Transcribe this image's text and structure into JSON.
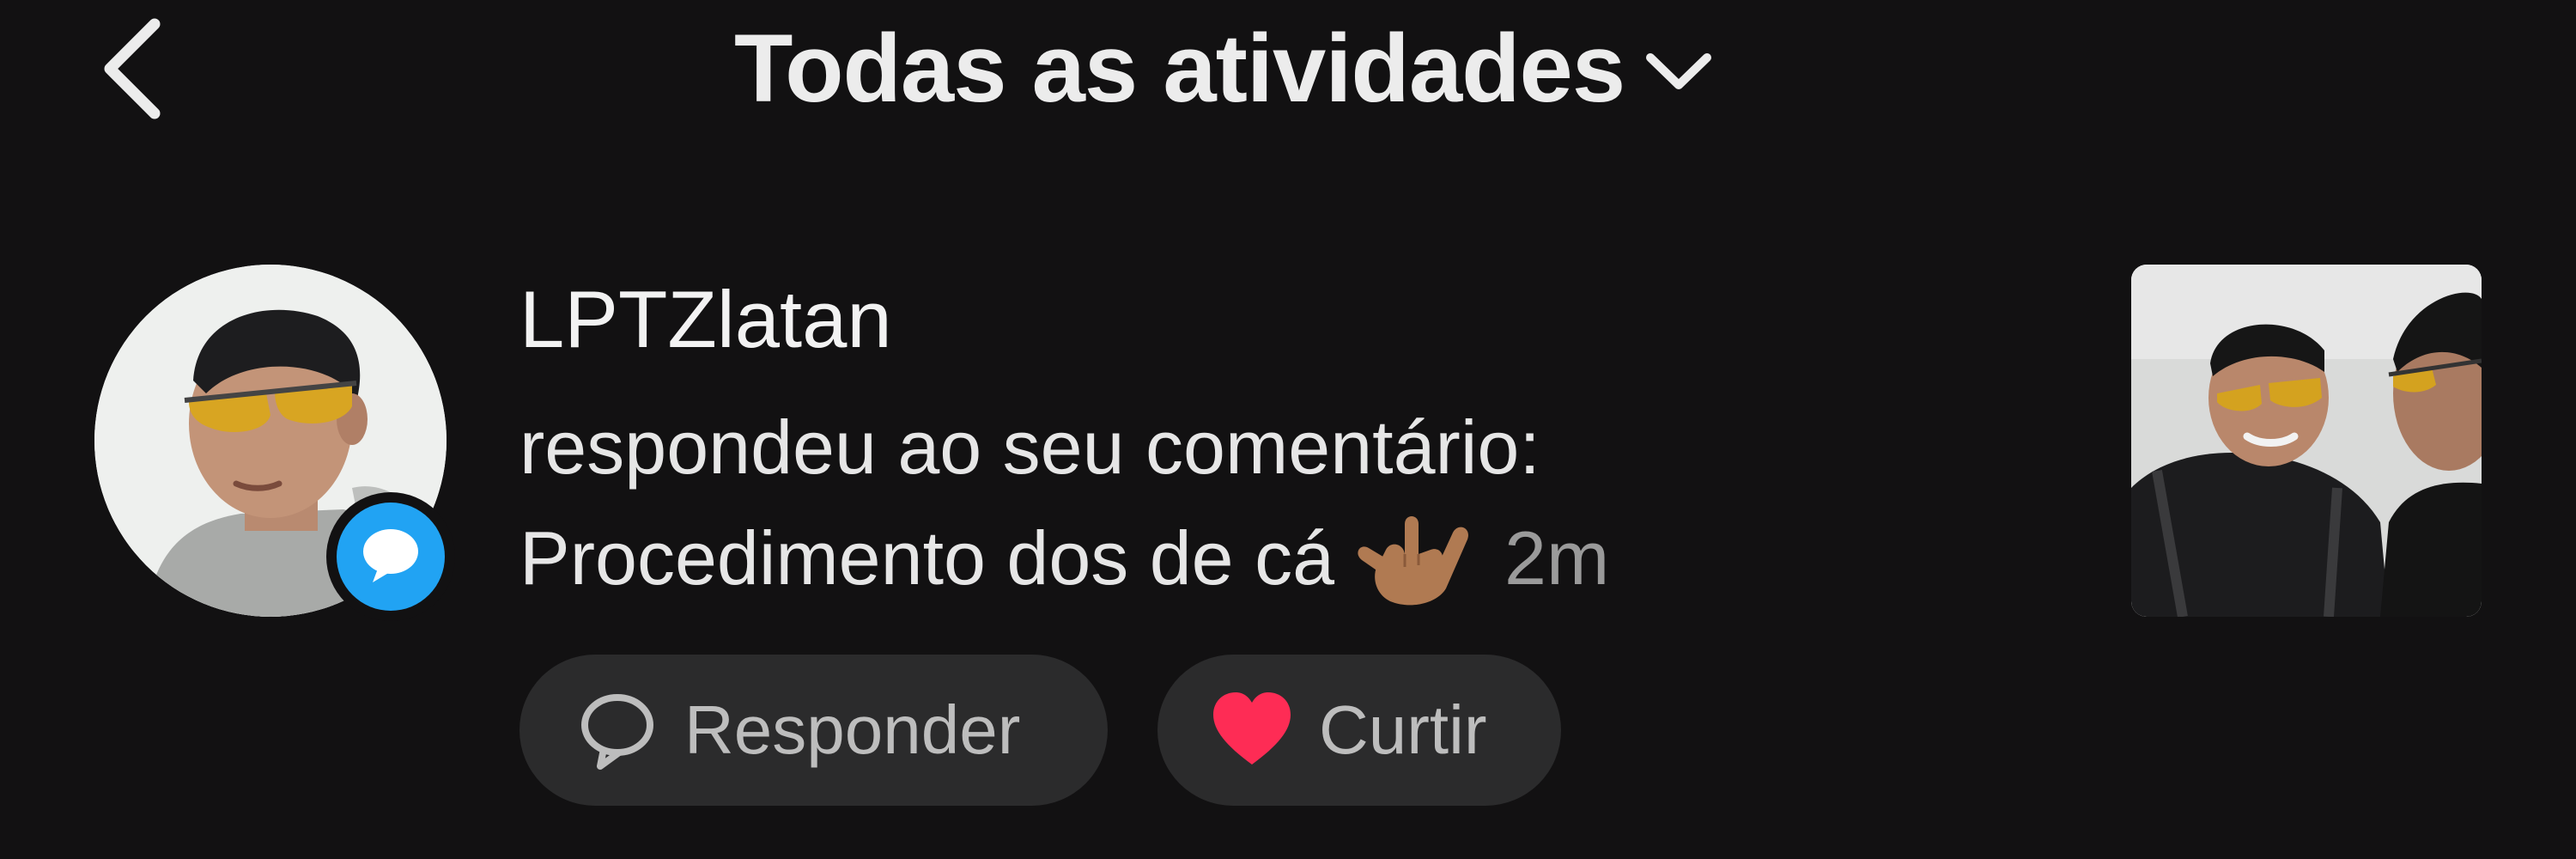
{
  "header": {
    "back_icon": "chevron-left-icon",
    "title": "Todas as atividades",
    "title_dropdown_icon": "chevron-down-icon"
  },
  "notification": {
    "avatar_icon": "user-avatar-photo",
    "badge_icon": "comment-bubble-icon",
    "username": "LPTZlatan",
    "action_text": "respondeu ao seu comentário:",
    "comment_text": "Procedimento dos de cá",
    "comment_emoji": "love-you-gesture-emoji",
    "time": "2m",
    "thumbnail_icon": "video-thumbnail"
  },
  "actions": {
    "reply_label": "Responder",
    "reply_icon": "comment-outline-icon",
    "like_label": "Curtir",
    "like_icon": "heart-icon"
  },
  "colors": {
    "background": "#121112",
    "pill_background": "#2b2b2c",
    "badge_blue": "#21a3f3",
    "heart_red": "#fe2c55",
    "muted_text": "#9a9a9a"
  }
}
